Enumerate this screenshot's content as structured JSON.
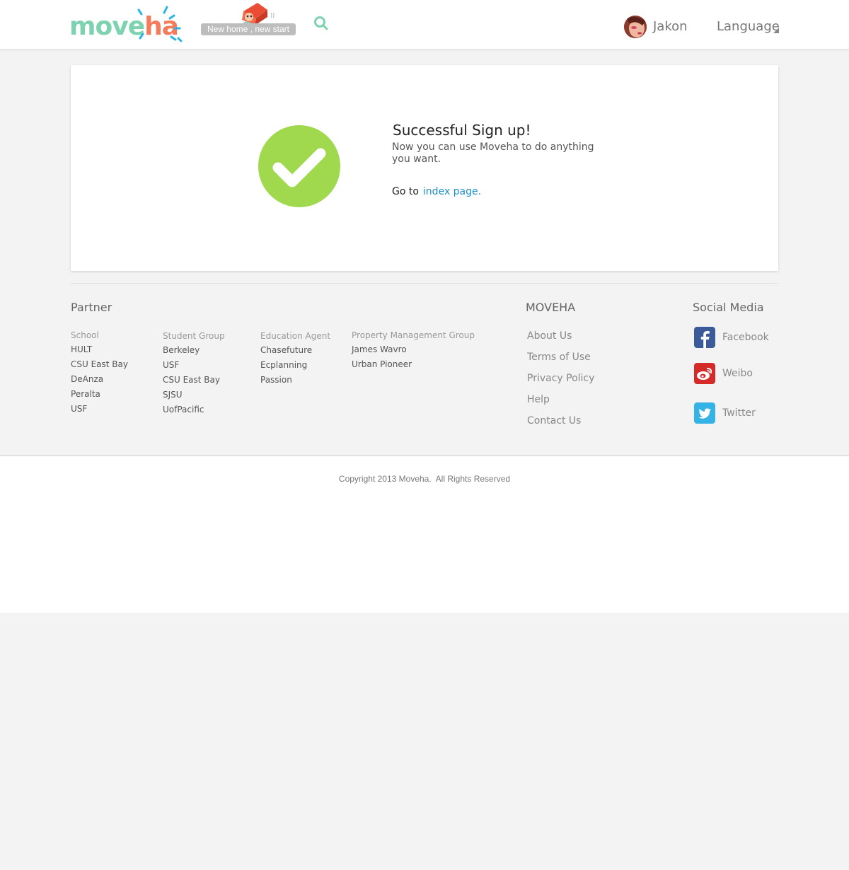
{
  "header": {
    "logo_part1": "move",
    "logo_part2": "ha",
    "tagline": "New home ,  new start",
    "username": "Jakon",
    "language": "Language",
    "icons": [
      "search-icon",
      "avatar",
      "caret-down-icon"
    ]
  },
  "card": {
    "title": "Successful Sign up!",
    "message": "Now you can use Moveha to do anything you want.",
    "goto_prefix": "Go to",
    "goto_link": "index page.",
    "check_color": "#a0d94e"
  },
  "footer": {
    "partner": {
      "title": "Partner",
      "columns": [
        {
          "heading": "School",
          "items": [
            "HULT",
            "CSU East Bay",
            "DeAnza",
            "Peralta",
            "USF"
          ]
        },
        {
          "heading": "Student Group",
          "items": [
            "Berkeley",
            "USF",
            "CSU East Bay",
            "SJSU",
            "UofPacific"
          ]
        },
        {
          "heading": "Education Agent",
          "items": [
            "Chasefuture",
            "Ecplanning",
            "Passion"
          ]
        },
        {
          "heading": "Property Management Group",
          "items": [
            "James Wavro",
            "Urban Pioneer"
          ]
        }
      ]
    },
    "moveha": {
      "title": "MOVEHA",
      "links": [
        "About Us",
        "Terms of Use",
        "Privacy Policy",
        "Help",
        "Contact Us"
      ]
    },
    "social": {
      "title": "Social Media",
      "items": [
        {
          "label": "Facebook",
          "icon": "facebook-icon",
          "color": "#3b5a9a"
        },
        {
          "label": "Weibo",
          "icon": "weibo-icon",
          "color": "#d52a2a"
        },
        {
          "label": "Twitter",
          "icon": "twitter-icon",
          "color": "#35b2e6"
        }
      ]
    },
    "copyright": "Copyright 2013 Moveha.  All Rights Reserved"
  }
}
